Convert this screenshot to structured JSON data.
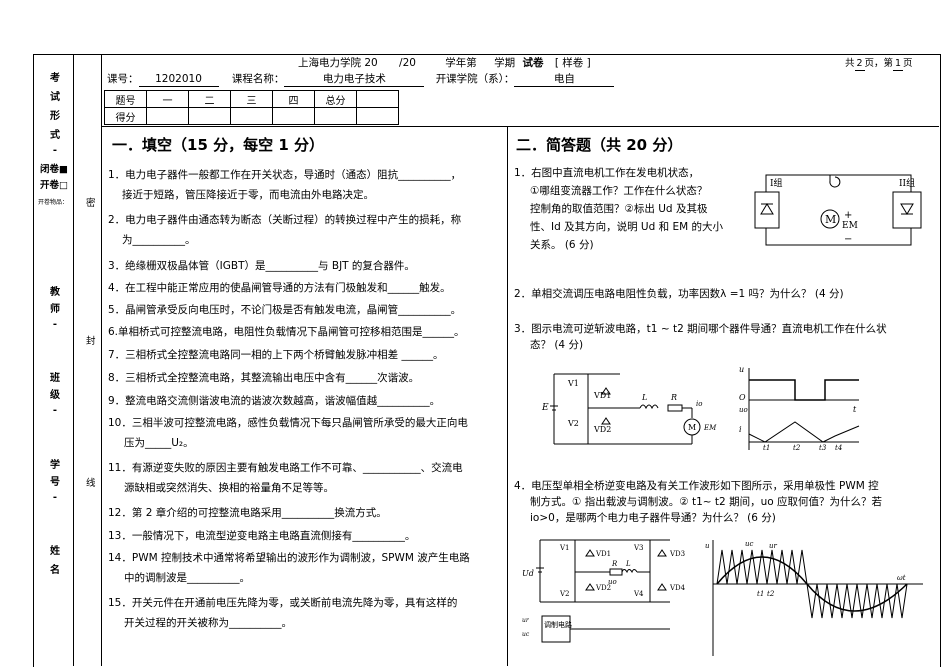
{
  "header": {
    "school": "上海电力学院 20",
    "year_sep": "/20",
    "year_label": "学年第",
    "term_label": "学期",
    "exam_label": "试卷",
    "sample": "[ 样卷 ]",
    "pages": "共",
    "pages_total": "2",
    "pages_mid": "页，第",
    "pages_current": "1",
    "pages_end": "页"
  },
  "course": {
    "code_label": "课号：",
    "code": "1202010",
    "name_label": "课程名称：",
    "name": "电力电子技术",
    "college_label": "开课学院（系）：",
    "college": "电自"
  },
  "score_table": {
    "row1": [
      "题号",
      "一",
      "二",
      "三",
      "四",
      "总分"
    ],
    "row2_label": "得分"
  },
  "side": {
    "exam_form": [
      "考",
      "试",
      "形",
      "式",
      "-"
    ],
    "closed": "闭卷",
    "closed_box": "■",
    "open": "开卷",
    "open_box": "□",
    "open_items": "开卷物品：",
    "teacher": [
      "教",
      "师",
      "-"
    ],
    "class": [
      "班",
      "级",
      "-"
    ],
    "student_id": [
      "学",
      "号",
      "-"
    ],
    "name": [
      "姓",
      "名"
    ],
    "seal": [
      "密",
      "封",
      "线"
    ]
  },
  "section1": {
    "title": "一．填空（15 分，每空 1 分）",
    "items": [
      [
        "1．电力电子器件一般都工作在开关状态，导通时（通态）阻抗__________，",
        "接近于短路，管压降接近于零，而电流由外电路决定。"
      ],
      [
        "2．电力电子器件由通态转为断态（关断过程）的转换过程中产生的损耗，称",
        "为__________。"
      ],
      [
        "3．绝缘栅双极晶体管（IGBT）是__________与 BJT 的复合器件。"
      ],
      [
        "4．在工程中能正常应用的使晶闸管导通的方法有门极触发和______触发。"
      ],
      [
        "5．晶闸管承受反向电压时，不论门极是否有触发电流，晶闸管__________。"
      ],
      [
        "6.单相桥式可控整流电路，电阻性负载情况下晶闸管可控移相范围是______。"
      ],
      [
        "7．三相桥式全控整流电路同一相的上下两个桥臂触发脉冲相差 ______。"
      ],
      [
        "8．三相桥式全控整流电路，其整流输出电压中含有______次谐波。"
      ],
      [
        "9．整流电路交流侧谐波电流的谐波次数越高，谐波幅值越__________。"
      ],
      [
        "10．三相半波可控整流电路，感性负载情况下每只晶闸管所承受的最大正向电",
        "压为_____U₂。"
      ],
      [
        "11．有源逆变失败的原因主要有触发电路工作不可靠、___________、交流电",
        "源缺相或突然消失、换相的裕量角不足等等。"
      ],
      [
        "12．第 2 章介绍的可控整流电路采用__________换流方式。"
      ],
      [
        "13．一般情况下，电流型逆变电路主电路直流侧接有__________。"
      ],
      [
        "14．PWM 控制技术中通常将希望输出的波形作为调制波，SPWM 波产生电路",
        "中的调制波是__________。"
      ],
      [
        "15．开关元件在开通前电压先降为零，或关断前电流先降为零，具有这样的",
        "开关过程的开关被称为__________。"
      ]
    ]
  },
  "section2": {
    "title": "二．简答题（共 20 分）",
    "q1": [
      "1．右图中直流电机工作在发电机状态，",
      "①哪组变流器工作？工作在什么状态？",
      "控制角的取值范围？②标出 Ud 及其极",
      "性、Id 及其方向，说明 Ud 和 EM 的大小",
      "关系。                      (6 分)"
    ],
    "q2": "2．单相交流调压电路电阻性负载，功率因数λ =1 吗？为什么？          (4 分)",
    "q3": [
      "3．图示电流可逆斩波电路，t1 ~ t2 期间哪个器件导通？直流电机工作在什么状",
      "态？                                                                            (4 分)"
    ],
    "q4": [
      "4．电压型单相全桥逆变电路及有关工作波形如下图所示，采用单极性  PWM 控",
      "制方式。① 指出载波与调制波。②  t1~ t2 期间，uo 应取何值？为什么？若",
      "io>0，是哪两个电力电子器件导通？为什么？                          (6 分)"
    ],
    "fig1": {
      "left": "I组",
      "right": "II组",
      "em": "EM",
      "m": "M",
      "plus": "+",
      "minus": "−"
    },
    "fig3": {
      "e": "E",
      "v1": "V1",
      "v2": "V2",
      "vd1": "VD1",
      "vd2": "VD2",
      "l": "L",
      "r": "R",
      "io": "io",
      "m": "M",
      "em": "EM",
      "u": "u",
      "uo": "uo",
      "o": "O",
      "t": "t",
      "i": "i",
      "t1": "t1",
      "t2": "t2",
      "t3": "t3",
      "t4": "t4"
    },
    "fig4": {
      "ud": "Ud",
      "v1": "V1",
      "v2": "V2",
      "v3": "V3",
      "v4": "V4",
      "vd1": "VD1",
      "vd2": "VD2",
      "vd3": "VD3",
      "vd4": "VD4",
      "r": "R",
      "l": "L",
      "uo": "uo",
      "ur": "ur",
      "uc": "uc",
      "ctrl": "调制电路",
      "t1": "t1",
      "t2": "t2",
      "wt": "ωt",
      "u": "u"
    }
  }
}
